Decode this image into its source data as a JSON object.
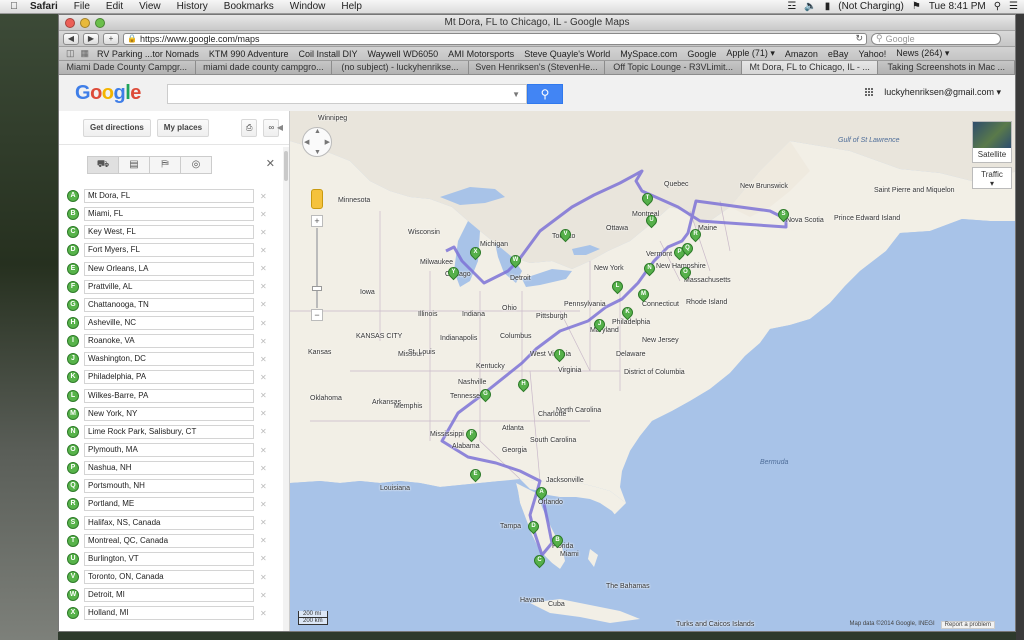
{
  "menubar": {
    "app": "Safari",
    "items": [
      "File",
      "Edit",
      "View",
      "History",
      "Bookmarks",
      "Window",
      "Help"
    ],
    "battery": "(Not Charging)",
    "clock": "Tue 8:41 PM"
  },
  "window": {
    "title": "Mt Dora, FL to Chicago, IL - Google Maps",
    "url": "https://www.google.com/maps",
    "search_placeholder": "Google"
  },
  "bookmarks": [
    "RV Parking ...tor Nomads",
    "KTM 990 Adventure",
    "Coil Install DIY",
    "Waywell WD6050",
    "AMI Motorsports",
    "Steve Quayle's World",
    "MySpace.com",
    "Google",
    "Apple (71) ▾",
    "Amazon",
    "eBay",
    "Yahoo!",
    "News (264) ▾"
  ],
  "tabs": [
    {
      "label": "Miami Dade County Campgr...",
      "active": false
    },
    {
      "label": "miami dade county campgro...",
      "active": false
    },
    {
      "label": "(no subject) - luckyhenrikse...",
      "active": false
    },
    {
      "label": "Sven Henriksen's (StevenHe...",
      "active": false
    },
    {
      "label": "Off Topic Lounge - R3VLimit...",
      "active": false
    },
    {
      "label": "Mt Dora, FL to Chicago, IL - ...",
      "active": true
    },
    {
      "label": "Taking Screenshots in Mac ...",
      "active": false
    }
  ],
  "google": {
    "logo": [
      "G",
      "o",
      "o",
      "g",
      "l",
      "e"
    ],
    "account": "luckyhenriksen@gmail.com ▾"
  },
  "panel": {
    "get_directions": "Get directions",
    "my_places": "My places",
    "stops": [
      {
        "letter": "A",
        "name": "Mt Dora, FL"
      },
      {
        "letter": "B",
        "name": "Miami, FL"
      },
      {
        "letter": "C",
        "name": "Key West, FL"
      },
      {
        "letter": "D",
        "name": "Fort Myers, FL"
      },
      {
        "letter": "E",
        "name": "New Orleans, LA"
      },
      {
        "letter": "F",
        "name": "Prattville, AL"
      },
      {
        "letter": "G",
        "name": "Chattanooga, TN"
      },
      {
        "letter": "H",
        "name": "Asheville, NC"
      },
      {
        "letter": "I",
        "name": "Roanoke, VA"
      },
      {
        "letter": "J",
        "name": "Washington, DC"
      },
      {
        "letter": "K",
        "name": "Philadelphia, PA"
      },
      {
        "letter": "L",
        "name": "Wilkes-Barre, PA"
      },
      {
        "letter": "M",
        "name": "New York, NY"
      },
      {
        "letter": "N",
        "name": "Lime Rock Park, Salisbury, CT"
      },
      {
        "letter": "O",
        "name": "Plymouth, MA"
      },
      {
        "letter": "P",
        "name": "Nashua, NH"
      },
      {
        "letter": "Q",
        "name": "Portsmouth, NH"
      },
      {
        "letter": "R",
        "name": "Portland, ME"
      },
      {
        "letter": "S",
        "name": "Halifax, NS, Canada"
      },
      {
        "letter": "T",
        "name": "Montreal, QC, Canada"
      },
      {
        "letter": "U",
        "name": "Burlington, VT"
      },
      {
        "letter": "V",
        "name": "Toronto, ON, Canada"
      },
      {
        "letter": "W",
        "name": "Detroit, MI"
      },
      {
        "letter": "X",
        "name": "Holland, MI"
      }
    ]
  },
  "map": {
    "buttons": {
      "satellite": "Satellite",
      "traffic": "Traffic"
    },
    "scale": {
      "top": "200 mi",
      "bottom": "200 km"
    },
    "attribution": "Map data ©2014 Google, INEGI",
    "report": "Report a problem",
    "labels": {
      "winnipeg": "Winnipeg",
      "minnesota": "Minnesota",
      "wisconsin": "Wisconsin",
      "milwaukee": "Milwaukee",
      "michigan": "Michigan",
      "detroit": "Detroit",
      "chicago": "Chicago",
      "iowa": "Iowa",
      "illinois": "Illinois",
      "indiana": "Indiana",
      "ohio": "Ohio",
      "kansas_city": "KANSAS CITY",
      "kansas": "Kansas",
      "missouri": "Missouri",
      "kentucky": "Kentucky",
      "tennessee": "Tennessee",
      "arkansas": "Arkansas",
      "oklahoma": "Oklahoma",
      "mississippi": "Mississippi",
      "alabama": "Alabama",
      "georgia": "Georgia",
      "louisiana": "Louisiana",
      "florida": "Florida",
      "jacksonville": "Jacksonville",
      "orlando": "Orlando",
      "tampa": "Tampa",
      "miami": "Miami",
      "pennsylvania": "Pennsylvania",
      "pittsburgh": "Pittsburgh",
      "columbus": "Columbus",
      "indianapolis": "Indianapolis",
      "st_louis": "St. Louis",
      "new_york": "New York",
      "toronto": "Toronto",
      "ottawa": "Ottawa",
      "montreal": "Montreal",
      "quebec": "Quebec",
      "vermont": "Vermont",
      "maine": "Maine",
      "new_brunswick": "New Brunswick",
      "nova_scotia": "Nova Scotia",
      "pei": "Prince Edward Island",
      "gulf": "Gulf of St Lawrence",
      "miquelon": "Saint Pierre and Miquelon",
      "virginia": "Virginia",
      "west_virginia": "West Virginia",
      "north_carolina": "North Carolina",
      "south_carolina": "South Carolina",
      "charlotte": "Charlotte",
      "delaware": "Delaware",
      "new_jersey": "New Jersey",
      "maryland": "Maryland",
      "dc": "District of Columbia",
      "philadelphia": "Philadelphia",
      "connecticut": "Connecticut",
      "rhode_island": "Rhode Island",
      "massachusetts": "Massachusetts",
      "new_hampshire": "New Hampshire",
      "bermuda": "Bermuda",
      "bahamas": "The Bahamas",
      "cuba": "Cuba",
      "turks": "Turks and Caicos Islands",
      "havana": "Havana",
      "nashville": "Nashville",
      "memphis": "Memphis",
      "atlanta": "Atlanta",
      "lake_erie": "Ottawa"
    },
    "pins": [
      "A",
      "B",
      "C",
      "D",
      "E",
      "F",
      "G",
      "H",
      "I",
      "J",
      "K",
      "L",
      "M",
      "N",
      "O",
      "P",
      "Q",
      "R",
      "S",
      "T",
      "U",
      "V",
      "W",
      "X",
      "Y"
    ]
  }
}
